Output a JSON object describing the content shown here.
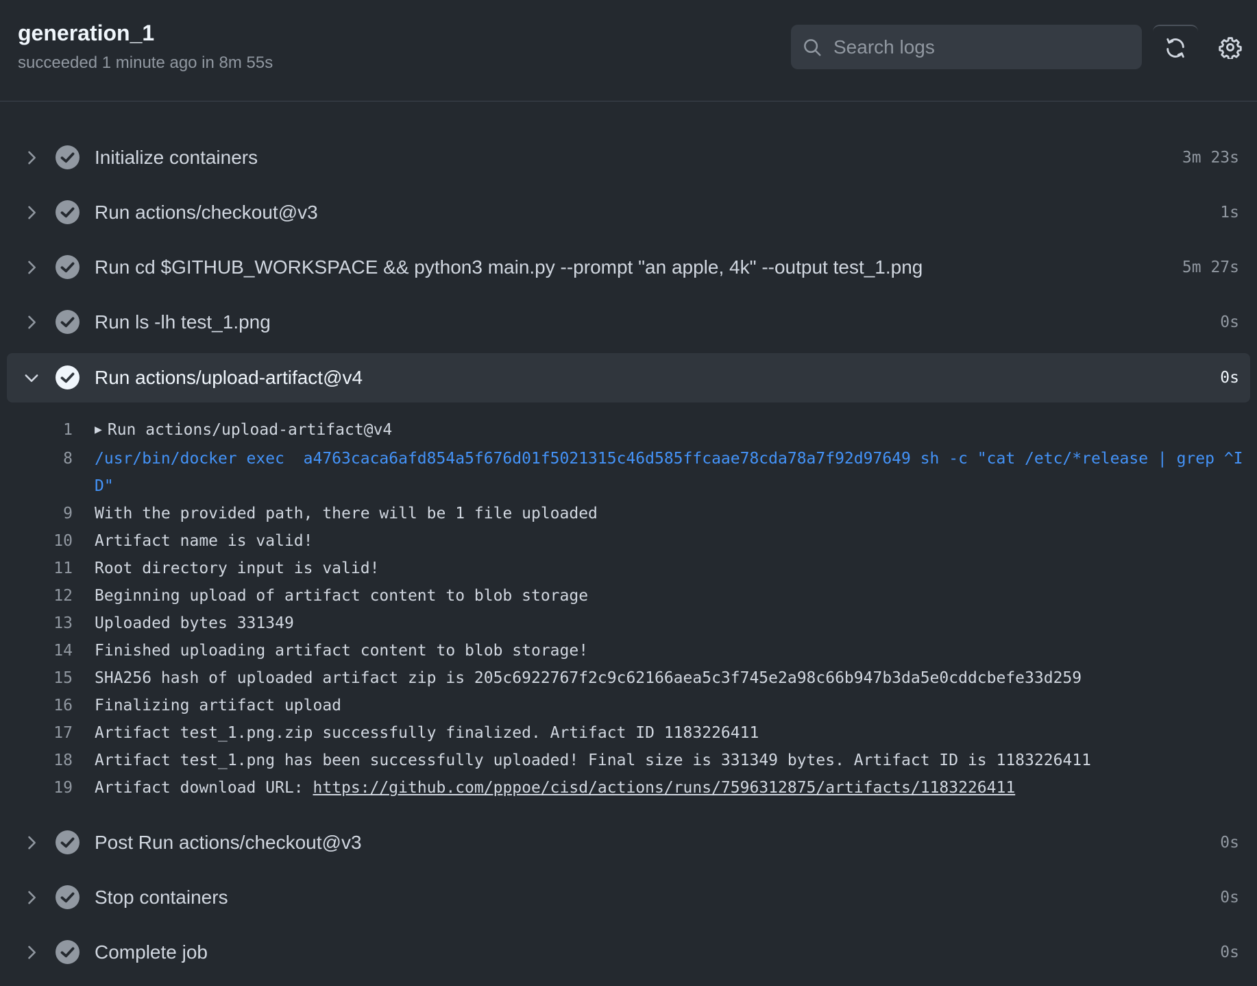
{
  "header": {
    "title": "generation_1",
    "subtitle": "succeeded 1 minute ago in 8m 55s",
    "search_placeholder": "Search logs"
  },
  "icons": {
    "search": "search-icon",
    "refresh": "refresh-icon",
    "settings": "gear-icon",
    "chevron_right": "chevron-right-icon",
    "chevron_down": "chevron-down-icon",
    "check": "check-circle-icon"
  },
  "colors": {
    "background": "#24292f",
    "expanded_row": "#30363d",
    "command_text": "#4493f8",
    "check_fill": "#9198a1",
    "check_fill_active": "#f0f6fc"
  },
  "steps_before": [
    {
      "name": "Initialize containers",
      "duration": "3m 23s"
    },
    {
      "name": "Run actions/checkout@v3",
      "duration": "1s"
    },
    {
      "name": "Run cd $GITHUB_WORKSPACE && python3 main.py --prompt \"an apple, 4k\" --output test_1.png",
      "duration": "5m 27s"
    },
    {
      "name": "Run ls -lh test_1.png",
      "duration": "0s"
    }
  ],
  "expanded_step": {
    "name": "Run actions/upload-artifact@v4",
    "duration": "0s"
  },
  "log_lines": [
    {
      "num": "1",
      "text": "Run actions/upload-artifact@v4",
      "type": "group"
    },
    {
      "num": "8",
      "text": "/usr/bin/docker exec  a4763caca6afd854a5f676d01f5021315c46d585ffcaae78cda78a7f92d97649 sh -c \"cat /etc/*release | grep ^ID\"",
      "type": "cmd"
    },
    {
      "num": "9",
      "text": "With the provided path, there will be 1 file uploaded",
      "type": "plain"
    },
    {
      "num": "10",
      "text": "Artifact name is valid!",
      "type": "plain"
    },
    {
      "num": "11",
      "text": "Root directory input is valid!",
      "type": "plain"
    },
    {
      "num": "12",
      "text": "Beginning upload of artifact content to blob storage",
      "type": "plain"
    },
    {
      "num": "13",
      "text": "Uploaded bytes 331349",
      "type": "plain"
    },
    {
      "num": "14",
      "text": "Finished uploading artifact content to blob storage!",
      "type": "plain"
    },
    {
      "num": "15",
      "text": "SHA256 hash of uploaded artifact zip is 205c6922767f2c9c62166aea5c3f745e2a98c66b947b3da5e0cddcbefe33d259",
      "type": "plain"
    },
    {
      "num": "16",
      "text": "Finalizing artifact upload",
      "type": "plain"
    },
    {
      "num": "17",
      "text": "Artifact test_1.png.zip successfully finalized. Artifact ID 1183226411",
      "type": "plain"
    },
    {
      "num": "18",
      "text": "Artifact test_1.png has been successfully uploaded! Final size is 331349 bytes. Artifact ID is 1183226411",
      "type": "plain"
    },
    {
      "num": "19",
      "text": "Artifact download URL: ",
      "link": "https://github.com/pppoe/cisd/actions/runs/7596312875/artifacts/1183226411",
      "type": "link"
    }
  ],
  "steps_after": [
    {
      "name": "Post Run actions/checkout@v3",
      "duration": "0s"
    },
    {
      "name": "Stop containers",
      "duration": "0s"
    },
    {
      "name": "Complete job",
      "duration": "0s"
    }
  ]
}
